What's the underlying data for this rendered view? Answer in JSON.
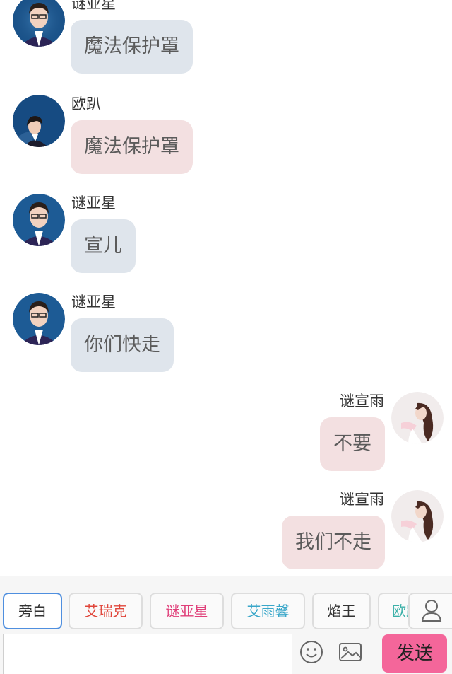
{
  "messages": [
    {
      "sender": "谜亚星",
      "text": "魔法保护罩",
      "side": "left",
      "bubble_color": "#dfe5ec",
      "avatar": "glasses-boy-avatar"
    },
    {
      "sender": "欧趴",
      "text": "魔法保护罩",
      "side": "left",
      "bubble_color": "#f3e0e1",
      "avatar": "boy-avatar"
    },
    {
      "sender": "谜亚星",
      "text": "宣儿",
      "side": "left",
      "bubble_color": "#dfe5ec",
      "avatar": "glasses-boy-avatar"
    },
    {
      "sender": "谜亚星",
      "text": "你们快走",
      "side": "left",
      "bubble_color": "#dfe5ec",
      "avatar": "glasses-boy-avatar"
    },
    {
      "sender": "谜宣雨",
      "text": "不要",
      "side": "right",
      "bubble_color": "#f3e0e1",
      "avatar": "girl-avatar"
    },
    {
      "sender": "谜宣雨",
      "text": "我们不走",
      "side": "right",
      "bubble_color": "#f3e0e1",
      "avatar": "girl-avatar"
    }
  ],
  "roles": [
    {
      "label": "旁白",
      "color": "#555555",
      "selected": true
    },
    {
      "label": "艾瑞克",
      "color": "#e0453a",
      "selected": false
    },
    {
      "label": "谜亚星",
      "color": "#e0407a",
      "selected": false
    },
    {
      "label": "艾雨馨",
      "color": "#3aa7c9",
      "selected": false
    },
    {
      "label": "焰王",
      "color": "#333333",
      "selected": false
    },
    {
      "label": "欧趴",
      "color": "#3bb0a8",
      "selected": false
    }
  ],
  "toolbar": {
    "role_icon": "user-icon",
    "emoji_icon": "smiley-icon",
    "image_icon": "image-icon",
    "send_label": "发送",
    "send_color": "#f4669a",
    "input_value": ""
  }
}
